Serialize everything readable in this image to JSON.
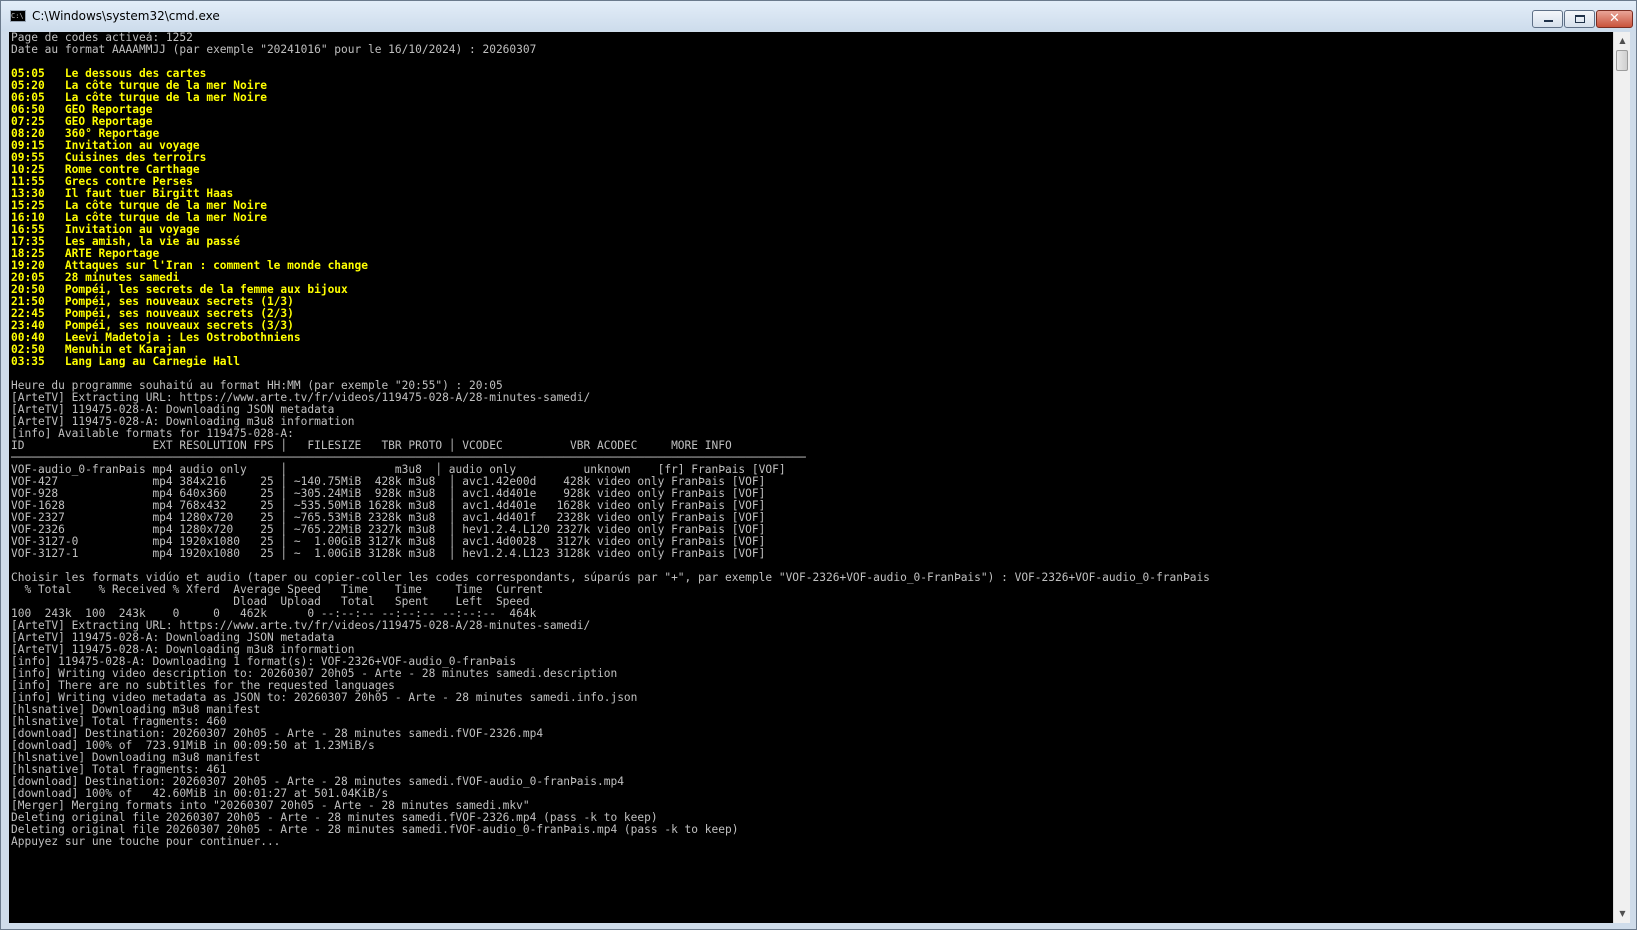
{
  "window": {
    "title": "C:\\Windows\\system32\\cmd.exe",
    "icon": "cmd-icon",
    "icon_text": "C:\\",
    "controls": {
      "minimize": "minimize-icon",
      "maximize": "maximize-icon",
      "close_glyph": "✕"
    }
  },
  "console": {
    "lines": [
      {
        "text": "Page de codes activeá: 1252",
        "yellow": false
      },
      {
        "text": "Date au format AAAAMMJJ (par exemple \"20241016\" pour le 16/10/2024) : 20260307",
        "yellow": false
      },
      {
        "text": "",
        "yellow": false
      },
      {
        "text": "05:05   Le dessous des cartes",
        "yellow": true
      },
      {
        "text": "05:20   La côte turque de la mer Noire",
        "yellow": true
      },
      {
        "text": "06:05   La côte turque de la mer Noire",
        "yellow": true
      },
      {
        "text": "06:50   GEO Reportage",
        "yellow": true
      },
      {
        "text": "07:25   GEO Reportage",
        "yellow": true
      },
      {
        "text": "08:20   360° Reportage",
        "yellow": true
      },
      {
        "text": "09:15   Invitation au voyage",
        "yellow": true
      },
      {
        "text": "09:55   Cuisines des terroirs",
        "yellow": true
      },
      {
        "text": "10:25   Rome contre Carthage",
        "yellow": true
      },
      {
        "text": "11:55   Grecs contre Perses",
        "yellow": true
      },
      {
        "text": "13:30   Il faut tuer Birgitt Haas",
        "yellow": true
      },
      {
        "text": "15:25   La côte turque de la mer Noire",
        "yellow": true
      },
      {
        "text": "16:10   La côte turque de la mer Noire",
        "yellow": true
      },
      {
        "text": "16:55   Invitation au voyage",
        "yellow": true
      },
      {
        "text": "17:35   Les amish, la vie au passé",
        "yellow": true
      },
      {
        "text": "18:25   ARTE Reportage",
        "yellow": true
      },
      {
        "text": "19:20   Attaques sur l'Iran : comment le monde change",
        "yellow": true
      },
      {
        "text": "20:05   28 minutes samedi",
        "yellow": true
      },
      {
        "text": "20:50   Pompéi, les secrets de la femme aux bijoux",
        "yellow": true
      },
      {
        "text": "21:50   Pompéi, ses nouveaux secrets (1/3)",
        "yellow": true
      },
      {
        "text": "22:45   Pompéi, ses nouveaux secrets (2/3)",
        "yellow": true
      },
      {
        "text": "23:40   Pompéi, ses nouveaux secrets (3/3)",
        "yellow": true
      },
      {
        "text": "00:40   Leevi Madetoja : Les Ostrobothniens",
        "yellow": true
      },
      {
        "text": "02:50   Menuhin et Karajan",
        "yellow": true
      },
      {
        "text": "03:35   Lang Lang au Carnegie Hall",
        "yellow": true
      },
      {
        "text": "",
        "yellow": false
      },
      {
        "text": "Heure du programme souhaitú au format HH:MM (par exemple \"20:55\") : 20:05",
        "yellow": false
      },
      {
        "text": "[ArteTV] Extracting URL: https://www.arte.tv/fr/videos/119475-028-A/28-minutes-samedi/",
        "yellow": false
      },
      {
        "text": "[ArteTV] 119475-028-A: Downloading JSON metadata",
        "yellow": false
      },
      {
        "text": "[ArteTV] 119475-028-A: Downloading m3u8 information",
        "yellow": false
      },
      {
        "text": "[info] Available formats for 119475-028-A:",
        "yellow": false
      },
      {
        "text": "ID                   EXT RESOLUTION FPS │   FILESIZE   TBR PROTO │ VCODEC          VBR ACODEC     MORE INFO",
        "yellow": false
      },
      {
        "text": "──────────────────────────────────────────────────────────────────────────────────────────────────────────────────────",
        "yellow": false
      },
      {
        "text": "VOF-audio_0-franÞais mp4 audio only     │                m3u8  │ audio only          unknown    [fr] FranÞais [VOF]",
        "yellow": false
      },
      {
        "text": "VOF-427              mp4 384x216     25 │ ~140.75MiB  428k m3u8  │ avc1.42e00d    428k video only FranÞais [VOF]",
        "yellow": false
      },
      {
        "text": "VOF-928              mp4 640x360     25 │ ~305.24MiB  928k m3u8  │ avc1.4d401e    928k video only FranÞais [VOF]",
        "yellow": false
      },
      {
        "text": "VOF-1628             mp4 768x432     25 │ ~535.50MiB 1628k m3u8  │ avc1.4d401e   1628k video only FranÞais [VOF]",
        "yellow": false
      },
      {
        "text": "VOF-2327             mp4 1280x720    25 │ ~765.53MiB 2328k m3u8  │ avc1.4d401f   2328k video only FranÞais [VOF]",
        "yellow": false
      },
      {
        "text": "VOF-2326             mp4 1280x720    25 │ ~765.22MiB 2327k m3u8  │ hev1.2.4.L120 2327k video only FranÞais [VOF]",
        "yellow": false
      },
      {
        "text": "VOF-3127-0           mp4 1920x1080   25 │ ~  1.00GiB 3127k m3u8  │ avc1.4d0028   3127k video only FranÞais [VOF]",
        "yellow": false
      },
      {
        "text": "VOF-3127-1           mp4 1920x1080   25 │ ~  1.00GiB 3128k m3u8  │ hev1.2.4.L123 3128k video only FranÞais [VOF]",
        "yellow": false
      },
      {
        "text": "",
        "yellow": false
      },
      {
        "text": "Choisir les formats vidúo et audio (taper ou copier-coller les codes correspondants, súparús par \"+\", par exemple \"VOF-2326+VOF-audio_0-FranÞais\") : VOF-2326+VOF-audio_0-franÞais",
        "yellow": false
      },
      {
        "text": "  % Total    % Received % Xferd  Average Speed   Time    Time     Time  Current",
        "yellow": false
      },
      {
        "text": "                                 Dload  Upload   Total   Spent    Left  Speed",
        "yellow": false
      },
      {
        "text": "100  243k  100  243k    0     0   462k      0 --:--:-- --:--:-- --:--:--  464k",
        "yellow": false
      },
      {
        "text": "[ArteTV] Extracting URL: https://www.arte.tv/fr/videos/119475-028-A/28-minutes-samedi/",
        "yellow": false
      },
      {
        "text": "[ArteTV] 119475-028-A: Downloading JSON metadata",
        "yellow": false
      },
      {
        "text": "[ArteTV] 119475-028-A: Downloading m3u8 information",
        "yellow": false
      },
      {
        "text": "[info] 119475-028-A: Downloading 1 format(s): VOF-2326+VOF-audio_0-franÞais",
        "yellow": false
      },
      {
        "text": "[info] Writing video description to: 20260307 20h05 - Arte - 28 minutes samedi.description",
        "yellow": false
      },
      {
        "text": "[info] There are no subtitles for the requested languages",
        "yellow": false
      },
      {
        "text": "[info] Writing video metadata as JSON to: 20260307 20h05 - Arte - 28 minutes samedi.info.json",
        "yellow": false
      },
      {
        "text": "[hlsnative] Downloading m3u8 manifest",
        "yellow": false
      },
      {
        "text": "[hlsnative] Total fragments: 460",
        "yellow": false
      },
      {
        "text": "[download] Destination: 20260307 20h05 - Arte - 28 minutes samedi.fVOF-2326.mp4",
        "yellow": false
      },
      {
        "text": "[download] 100% of  723.91MiB in 00:09:50 at 1.23MiB/s",
        "yellow": false
      },
      {
        "text": "[hlsnative] Downloading m3u8 manifest",
        "yellow": false
      },
      {
        "text": "[hlsnative] Total fragments: 461",
        "yellow": false
      },
      {
        "text": "[download] Destination: 20260307 20h05 - Arte - 28 minutes samedi.fVOF-audio_0-franÞais.mp4",
        "yellow": false
      },
      {
        "text": "[download] 100% of   42.60MiB in 00:01:27 at 501.04KiB/s",
        "yellow": false
      },
      {
        "text": "[Merger] Merging formats into \"20260307 20h05 - Arte - 28 minutes samedi.mkv\"",
        "yellow": false
      },
      {
        "text": "Deleting original file 20260307 20h05 - Arte - 28 minutes samedi.fVOF-2326.mp4 (pass -k to keep)",
        "yellow": false
      },
      {
        "text": "Deleting original file 20260307 20h05 - Arte - 28 minutes samedi.fVOF-audio_0-franÞais.mp4 (pass -k to keep)",
        "yellow": false
      },
      {
        "text": "Appuyez sur une touche pour continuer...",
        "yellow": false
      }
    ]
  },
  "scrollbar": {
    "up_icon": "scroll-up-arrow-icon",
    "down_icon": "scroll-down-arrow-icon",
    "up_glyph": "▲",
    "down_glyph": "▼"
  }
}
